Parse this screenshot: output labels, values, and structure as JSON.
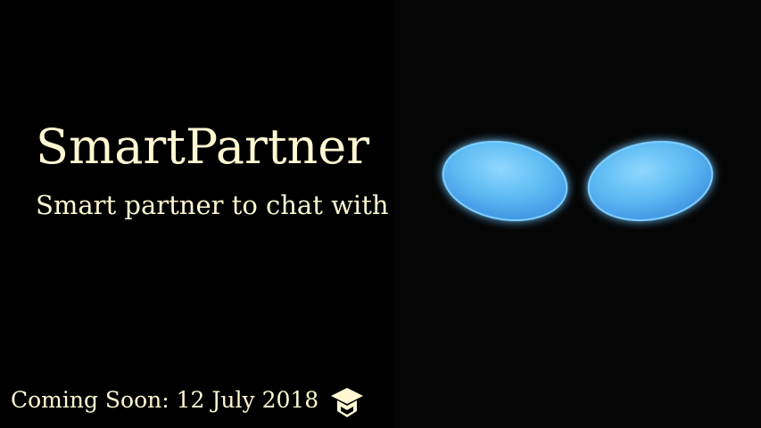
{
  "hero": {
    "title": "SmartPartner",
    "subtitle": "Smart partner to chat with"
  },
  "footer": {
    "coming_soon": "Coming Soon: 12 July 2018",
    "icon": "graduation-cap-icon"
  },
  "graphic": {
    "name": "glowing-eyes",
    "eye_color": "#59b8f0",
    "glow_color": "#4aa3ff"
  },
  "colors": {
    "background": "#000000",
    "text": "#fff8d2"
  }
}
